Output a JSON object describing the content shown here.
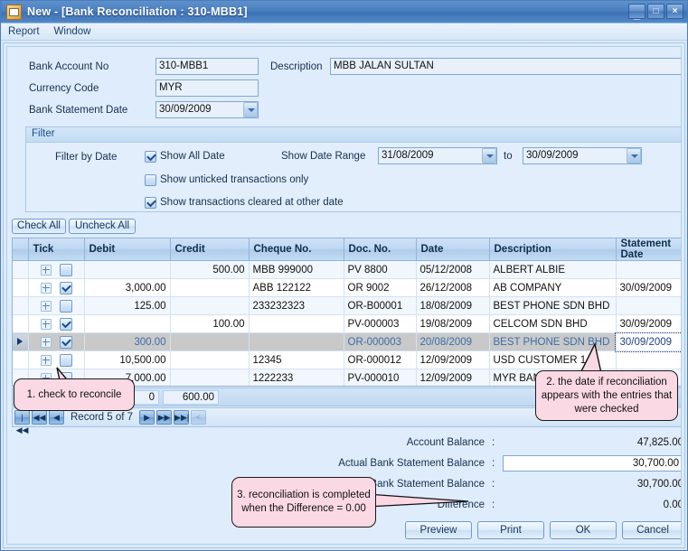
{
  "window": {
    "title": "New  - [Bank Reconciliation : 310-MBB1]",
    "icon": "document-icon",
    "buttons": {
      "minimize": "_",
      "maximize": "□",
      "close": "×"
    }
  },
  "menu": {
    "items": [
      "Report",
      "Window"
    ]
  },
  "form": {
    "bank_account_no_label": "Bank Account No",
    "bank_account_no_value": "310-MBB1",
    "currency_code_label": "Currency Code",
    "currency_code_value": "MYR",
    "bank_statement_date_label": "Bank Statement Date",
    "bank_statement_date_value": "30/09/2009",
    "description_label": "Description",
    "description_value": "MBB JALAN SULTAN"
  },
  "filter": {
    "caption": "Filter",
    "filter_by_date_label": "Filter by Date",
    "show_all_date_label": "Show All Date",
    "show_all_date_checked": true,
    "show_unticked_label": "Show unticked transactions only",
    "show_unticked_checked": false,
    "show_cleared_label": "Show transactions cleared at other date",
    "show_cleared_checked": true,
    "show_date_range_label": "Show Date Range",
    "date_from": "31/08/2009",
    "to_label": "to",
    "date_to": "30/09/2009"
  },
  "toolbar": {
    "check_all_label": "Check All",
    "uncheck_all_label": "Uncheck All"
  },
  "grid": {
    "columns": [
      "Tick",
      "Debit",
      "Credit",
      "Cheque No.",
      "Doc. No.",
      "Date",
      "Description",
      "Statement Date"
    ],
    "rows": [
      {
        "checked": false,
        "debit": "",
        "credit": "500.00",
        "cheque": "MBB 999000",
        "doc": "PV 8800",
        "date": "05/12/2008",
        "description": "ALBERT ALBIE",
        "statement_date": "",
        "selected": false
      },
      {
        "checked": true,
        "debit": "3,000.00",
        "credit": "",
        "cheque": "ABB 122122",
        "doc": "OR 9002",
        "date": "26/12/2008",
        "description": "AB COMPANY",
        "statement_date": "30/09/2009",
        "selected": false
      },
      {
        "checked": false,
        "debit": "125.00",
        "credit": "",
        "cheque": "233232323",
        "doc": "OR-B00001",
        "date": "18/08/2009",
        "description": "BEST PHONE SDN BHD",
        "statement_date": "",
        "selected": false
      },
      {
        "checked": true,
        "debit": "",
        "credit": "100.00",
        "cheque": "",
        "doc": "PV-000003",
        "date": "19/08/2009",
        "description": "CELCOM SDN BHD",
        "statement_date": "30/09/2009",
        "selected": false
      },
      {
        "checked": true,
        "debit": "300.00",
        "credit": "",
        "cheque": "",
        "doc": "OR-000003",
        "date": "20/08/2009",
        "description": "BEST PHONE SDN BHD",
        "statement_date": "30/09/2009",
        "selected": true
      },
      {
        "checked": false,
        "debit": "10,500.00",
        "credit": "",
        "cheque": "12345",
        "doc": "OR-000012",
        "date": "12/09/2009",
        "description": "USD CUSTOMER 1",
        "statement_date": "",
        "selected": false
      },
      {
        "checked": false,
        "debit": "7,000.00",
        "credit": "",
        "cheque": "1222233",
        "doc": "PV-000010",
        "date": "12/09/2009",
        "description": "MYR BANK ACCOUNT",
        "statement_date": "",
        "selected": false
      }
    ],
    "summary": {
      "debit_total": "0",
      "credit_total": "600.00"
    },
    "navigation": {
      "first": "|◀◀",
      "prev_page": "◀◀",
      "prev": "◀",
      "record_label": "Record 5 of 7",
      "next": "▶",
      "next_page": "▶▶",
      "last": "▶▶|",
      "extra": "<"
    }
  },
  "totals": {
    "account_balance_label": "Account Balance",
    "account_balance_value": "47,825.00",
    "actual_balance_label": "Actual Bank Statement Balance",
    "actual_balance_value": "30,700.00",
    "system_balance_label": "System Bank Statement Balance",
    "system_balance_value": "30,700.00",
    "difference_label": "Difference",
    "difference_value": "0.00",
    "colon": ":"
  },
  "footer_buttons": {
    "preview": "Preview",
    "print": "Print",
    "ok": "OK",
    "cancel": "Cancel"
  },
  "callouts": {
    "one": "1. check to reconcile",
    "two": "2. the date if reconciliation appears with the entries that were checked",
    "three": "3. reconciliation is completed when the Difference = 0.00"
  },
  "colors": {
    "title_blue": "#4a7fc0",
    "body_blue": "#dcebfa",
    "callout_pink": "#fbd9e4",
    "link_blue": "#1b47a0"
  }
}
